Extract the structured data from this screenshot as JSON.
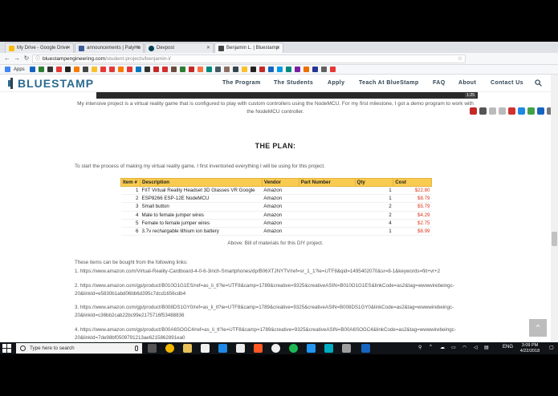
{
  "browser": {
    "tabs": [
      {
        "title": "My Drive - Google Drive",
        "color": "#fbbc04"
      },
      {
        "title": "announcements | PalyHo",
        "color": "#3b5b99"
      },
      {
        "title": "Devpost",
        "color": "#003e54"
      },
      {
        "title": "Benjamin L. | Bluestamp",
        "color": "#444444"
      }
    ],
    "url_host": "bluestampengineering.com",
    "url_path": "/student-projects/benjamin-l/",
    "bookmarks_label": "Apps"
  },
  "site": {
    "logo_text": "BLUESTAMP",
    "nav": [
      "The Program",
      "The Students",
      "Apply",
      "Teach At BlueStamp",
      "FAQ",
      "About",
      "Contact Us"
    ],
    "accent": "#2b6a8f"
  },
  "video_badge": "1:25",
  "content": {
    "intro": "My intensive project is a virtual reality game that is configured to play with custom controllers using the NodeMCU. For my first milestone, I got a demo program to work with the NodeMCU controller.",
    "plan_title": "THE PLAN:",
    "start_text": "To start the process of making my virtual reality game, I first inventoried everything I will be using for this project.",
    "table": {
      "headers": [
        "Item #",
        "Description",
        "Vendor",
        "Part Number",
        "Qty",
        "Cost"
      ],
      "rows": [
        [
          "1",
          "FIIT Virtual Reality Headset 3D Glasses VR Google",
          "Amazon",
          "",
          "1",
          "$22.80"
        ],
        [
          "2",
          "ESP8266 ESP-12E NodeMCU",
          "Amazon",
          "",
          "1",
          "$8.79"
        ],
        [
          "3",
          "Small button",
          "Amazon",
          "",
          "2",
          "$5.79"
        ],
        [
          "4",
          "Male to female jumper wires",
          "Amazon",
          "",
          "2",
          "$4.29"
        ],
        [
          "5",
          "Female to female jumper wires",
          "Amazon",
          "",
          "4",
          "$2.75"
        ],
        [
          "6",
          "3.7v rechargable lithium ion battery",
          "Amazon",
          "",
          "1",
          "$8.99"
        ]
      ],
      "header_color": "#f9cb50",
      "cost_color": "#d9361c"
    },
    "caption": "Above: Bill of materials for this DIY project.",
    "buy_text": "These items can be bought from the following links:",
    "links": [
      "1. https://www.amazon.com/Virtual-Reality-Cardboard-4-0-6-3inch-Smartphones/dp/B06XTJNYTV/ref=sr_1_1?ie=UTF8&qid=1495402070&sr=8-1&keywords=fiit+vr+2",
      "2. https://www.amazon.com/gp/product/B010O1G1ES/ref=as_li_tl?ie=UTF8&camp=1789&creative=9325&creativeASIN=B010O1G1ES&linkCode=as2&tag=wwwwirebeingc-20&linkId=e5830b1abd06bb6d395c7dcd1656cdb4",
      "3. https://www.amazon.com/gp/product/B008DS1GY0/ref=as_li_tl?ie=UTF8&camp=1789&creative=9325&creativeASIN=B008DS1GY0&linkCode=as2&tag=wwwwirebeingc-20&linkId=c36bb2cab22bc99e2175716f53488836",
      "4. https://www.amazon.com/gp/product/B00A6SOGC4/ref=as_li_tl?ie=UTF8&camp=1789&creative=9325&creativeASIN=B00A6SOGC4&linkCode=as2&tag=wwwwirebeingc-20&linkId=7de98bf0509791213ae6215862891ea0"
    ]
  },
  "taskbar": {
    "search_placeholder": "Type here to search",
    "lang": "ENG",
    "time": "3:09 PM",
    "date": "4/22/2018"
  }
}
